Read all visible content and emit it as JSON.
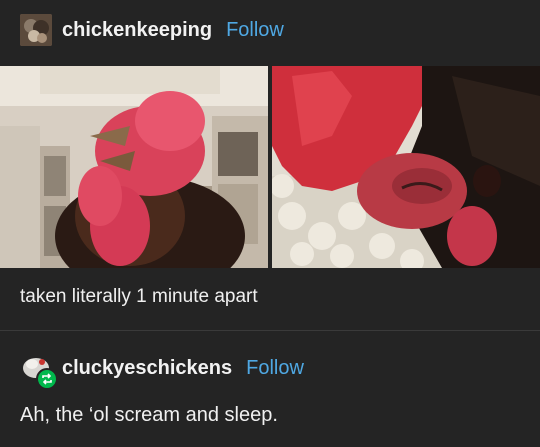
{
  "post": {
    "username": "chickenkeeping",
    "follow_label": "Follow",
    "caption": "taken literally 1 minute apart",
    "images": [
      {
        "name": "rooster-screaming-photo"
      },
      {
        "name": "rooster-sleeping-photo"
      }
    ]
  },
  "reblog": {
    "username": "cluckyeschickens",
    "follow_label": "Follow",
    "text": "Ah, the ‘ol scream and sleep."
  },
  "colors": {
    "background": "#242424",
    "follow": "#4fa8e3",
    "reblog_badge": "#00b84c"
  }
}
